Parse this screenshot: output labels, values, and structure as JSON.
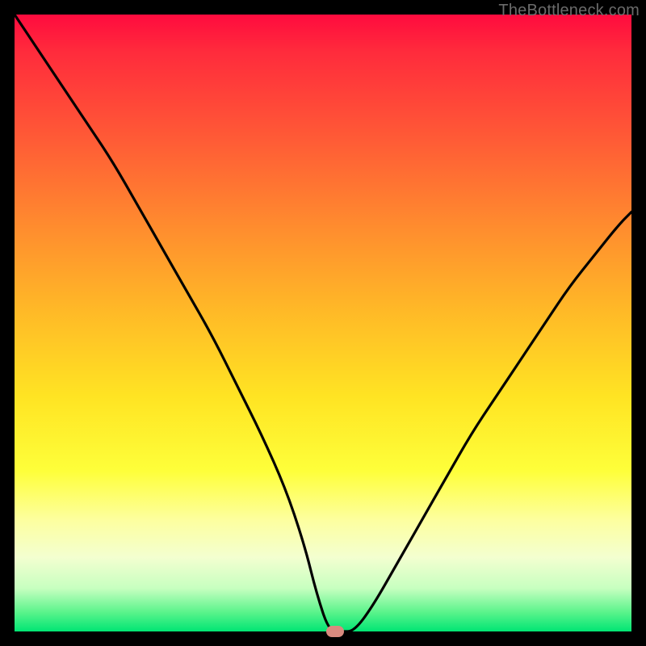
{
  "watermark": "TheBottleneck.com",
  "chart_data": {
    "type": "line",
    "title": "",
    "xlabel": "",
    "ylabel": "",
    "xlim": [
      0,
      100
    ],
    "ylim": [
      0,
      100
    ],
    "grid": false,
    "series": [
      {
        "name": "bottleneck-curve",
        "x": [
          0,
          4,
          8,
          12,
          16,
          20,
          24,
          28,
          32,
          36,
          40,
          44,
          47,
          49,
          51,
          53,
          55,
          58,
          62,
          66,
          70,
          74,
          78,
          82,
          86,
          90,
          94,
          98,
          100
        ],
        "values": [
          100,
          94,
          88,
          82,
          76,
          69,
          62,
          55,
          48,
          40,
          32,
          23,
          14,
          6,
          0,
          0,
          0,
          4,
          11,
          18,
          25,
          32,
          38,
          44,
          50,
          56,
          61,
          66,
          68
        ]
      }
    ],
    "marker": {
      "x": 52,
      "y": 0,
      "color": "#d88a7f"
    },
    "background_gradient": {
      "top": "#ff0b3e",
      "mid_upper": "#ff8e2e",
      "mid": "#ffe423",
      "mid_lower": "#fdffa0",
      "bottom": "#00e574"
    }
  }
}
